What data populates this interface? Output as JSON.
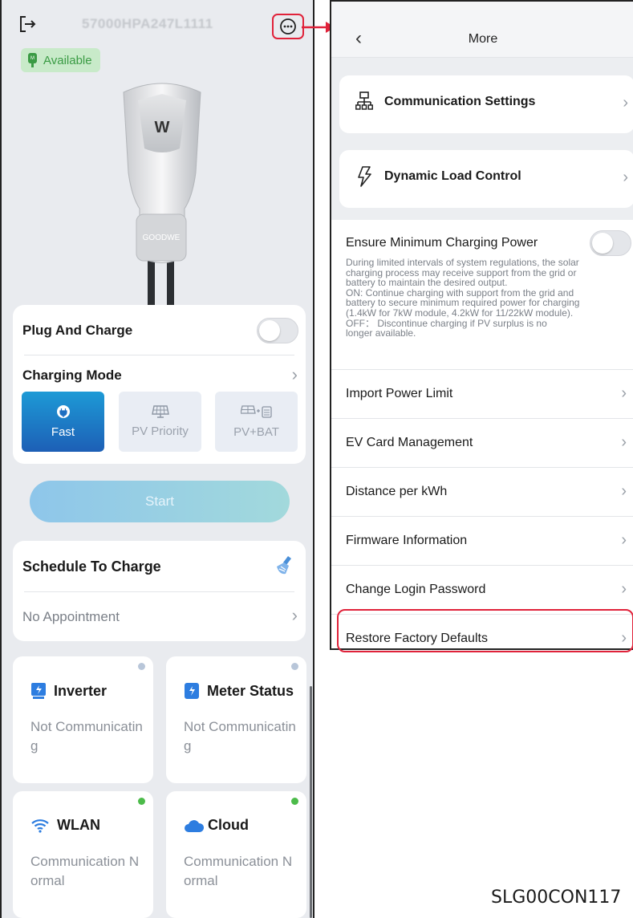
{
  "left": {
    "serial": "57000HPA247L1111",
    "status_badge": "Available",
    "charger_brand": "GOODWE",
    "plug_and_charge_label": "Plug And Charge",
    "charging_mode_label": "Charging Mode",
    "modes": [
      {
        "label": "Fast",
        "active": true
      },
      {
        "label": "PV Priority",
        "active": false
      },
      {
        "label": "PV+BAT",
        "active": false
      }
    ],
    "start_label": "Start",
    "schedule": {
      "title": "Schedule To Charge",
      "value": "No Appointment"
    },
    "tiles": [
      {
        "title": "Inverter",
        "status": "Not Communicating",
        "dot_color": "#b8c6d9"
      },
      {
        "title": "Meter Status",
        "status": "Not Communicating",
        "dot_color": "#b8c6d9"
      },
      {
        "title": "WLAN",
        "status": "Communication Normal",
        "dot_color": "#4cbb4a"
      },
      {
        "title": "Cloud",
        "status": "Communication Normal",
        "dot_color": "#4cbb4a"
      }
    ]
  },
  "right": {
    "title": "More",
    "cards": [
      {
        "label": "Communication Settings",
        "icon": "network-icon"
      },
      {
        "label": "Dynamic Load Control",
        "icon": "lightning-icon"
      }
    ],
    "ensure": {
      "title": "Ensure Minimum Charging Power",
      "lines": [
        "During limited intervals of system regulations, the solar",
        "charging process may receive support from the grid or",
        "battery to maintain the desired output.",
        "ON: Continue charging with support from the grid and",
        "battery to secure minimum required power for charging",
        "(1.4kW for 7kW module, 4.2kW for 11/22kW module).",
        "OFF： Discontinue charging if PV surplus is no",
        "longer available."
      ]
    },
    "items": [
      "Import Power Limit",
      "EV Card Management",
      "Distance per kWh",
      "Firmware Information",
      "Change Login Password",
      "Restore Factory Defaults"
    ]
  },
  "figure_code": "SLG00CON117",
  "colors": {
    "accent_red": "#e0223a",
    "fast_blue": "#1d7ec6",
    "ok_green": "#4cbb4a"
  }
}
